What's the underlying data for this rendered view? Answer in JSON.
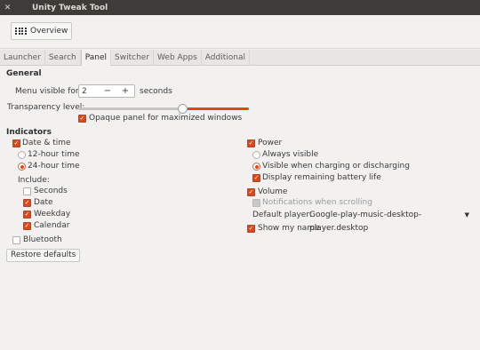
{
  "window": {
    "title": "Unity Tweak Tool",
    "close_glyph": "✕"
  },
  "toolbar": {
    "overview_label": "Overview"
  },
  "tabs": [
    {
      "label": "Launcher",
      "active": false
    },
    {
      "label": "Search",
      "active": false
    },
    {
      "label": "Panel",
      "active": true
    },
    {
      "label": "Switcher",
      "active": false
    },
    {
      "label": "Web Apps",
      "active": false
    },
    {
      "label": "Additional",
      "active": false
    }
  ],
  "general": {
    "title": "General",
    "menu_visible_label": "Menu visible for:",
    "menu_visible_value": "2",
    "minus": "−",
    "plus": "+",
    "seconds_label": "seconds",
    "transparency_label": "Transparency level:",
    "transparency_level": 0.61,
    "opaque_label": "Opaque panel for maximized windows",
    "opaque_checked": true
  },
  "indicators": {
    "title": "Indicators",
    "datetime_label": "Date & time",
    "h12_label": "12-hour time",
    "h24_label": "24-hour time",
    "include_label": "Include:",
    "seconds_label": "Seconds",
    "date_label": "Date",
    "weekday_label": "Weekday",
    "calendar_label": "Calendar",
    "bluetooth_label": "Bluetooth",
    "power_label": "Power",
    "always_visible_label": "Always visible",
    "visible_charging_label": "Visible when charging or discharging",
    "display_battery_label": "Display remaining battery life",
    "volume_label": "Volume",
    "notifications_scroll_label": "Notifications when scrolling",
    "default_player_label": "Default player:",
    "default_player_value": "Google-play-music-desktop-player.desktop",
    "show_my_name_label": "Show my name",
    "check_glyph": "✓",
    "dropdown_glyph": "▼"
  },
  "restore_label": "Restore defaults",
  "colors": {
    "accent": "#dd4814",
    "titlebar": "#3d3c38",
    "background": "#f2f1f0"
  }
}
